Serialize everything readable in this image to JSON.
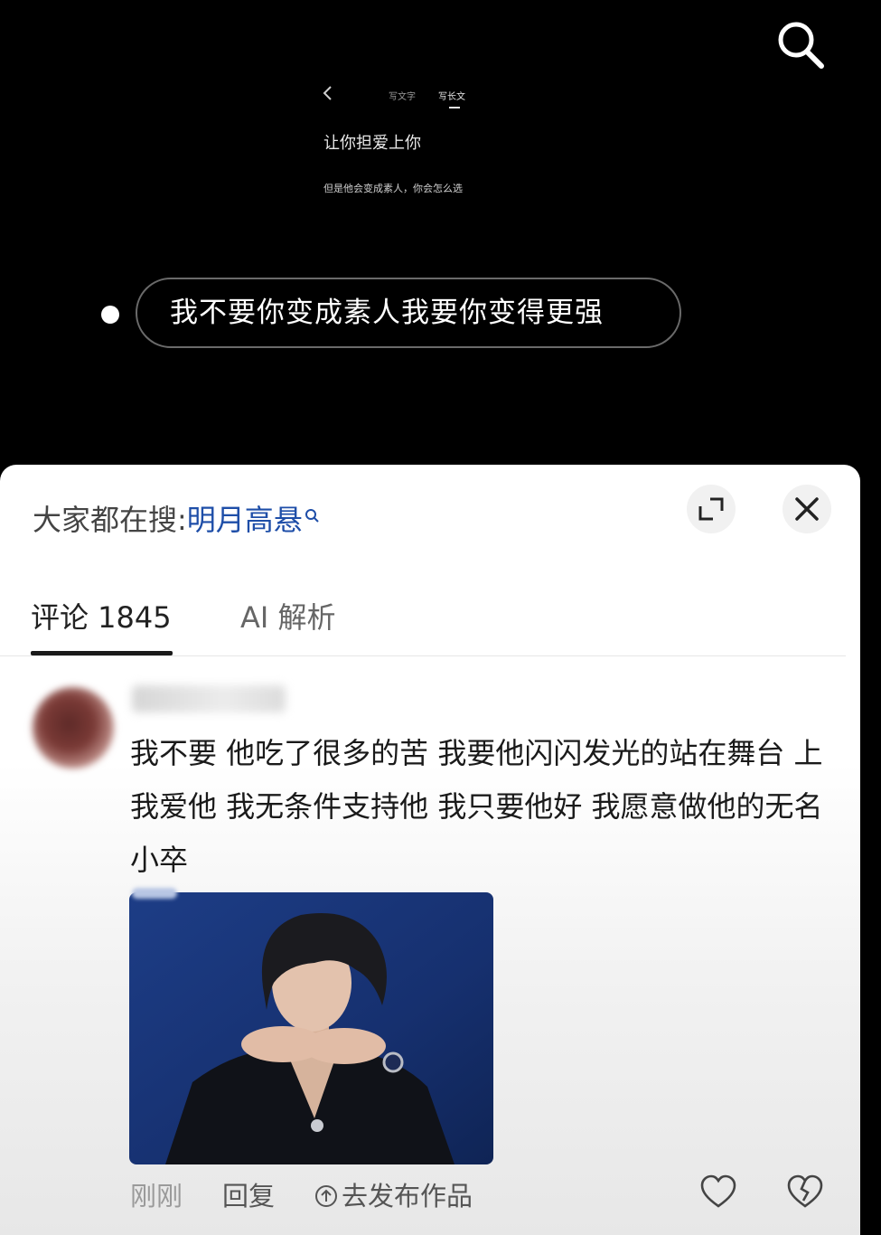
{
  "top": {
    "search_icon": "search-icon",
    "mini_editor": {
      "tab_text": "写文字",
      "tab_long": "写长文",
      "title": "让你担爱上你",
      "subtitle": "但是他会变成素人，你会怎么选"
    },
    "option_text": "我不要你变成素人我要你变得更强"
  },
  "sheet": {
    "trending_prefix": "大家都在搜:",
    "trending_keyword": "明月高悬",
    "tabs": [
      {
        "label": "评论 1845",
        "active": true
      },
      {
        "label": "AI 解析",
        "active": false
      }
    ],
    "comment": {
      "text": "我不要 他吃了很多的苦 我要他闪闪发光的站在舞台 上 我爱他 我无条件支持他 我只要他好 我愿意做他的无名小卒",
      "time": "刚刚",
      "reply_label": "回复",
      "publish_label": "去发布作品"
    }
  },
  "colors": {
    "accent_link": "#1e4ea8",
    "background_top": "#000000"
  }
}
